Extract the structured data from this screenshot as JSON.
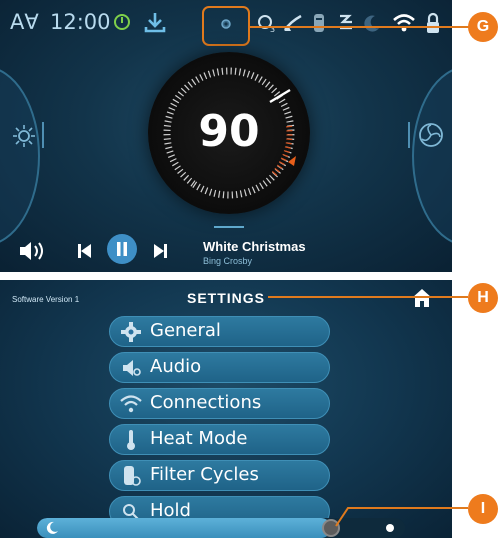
{
  "colors": {
    "accent": "#ee7b1d",
    "screen_bg": "#12344a",
    "menu_button": "#2a72a0",
    "text": "#ffffff"
  },
  "home": {
    "status": {
      "auto_label": "A∀",
      "time": "12:00",
      "icons": [
        "power-icon",
        "download-icon",
        "gear-icon",
        "ozone-icon",
        "brush-icon",
        "filter-icon",
        "lines-icon",
        "moon-icon",
        "wifi-icon",
        "lock-icon"
      ]
    },
    "temperature": "90",
    "media": {
      "title": "White Christmas",
      "artist": "Bing Crosby"
    }
  },
  "settings": {
    "software_version": "Software Version 1",
    "title": "SETTINGS",
    "menu": [
      {
        "label": "General",
        "icon": "gear-icon"
      },
      {
        "label": "Audio",
        "icon": "speaker-icon"
      },
      {
        "label": "Connections",
        "icon": "wifi-icon"
      },
      {
        "label": "Heat Mode",
        "icon": "thermometer-icon"
      },
      {
        "label": "Filter Cycles",
        "icon": "filter-icon"
      },
      {
        "label": "Hold",
        "icon": "hold-icon"
      }
    ],
    "brightness_level": 0.8
  },
  "callouts": {
    "g": "G",
    "h": "H",
    "i": "I"
  }
}
